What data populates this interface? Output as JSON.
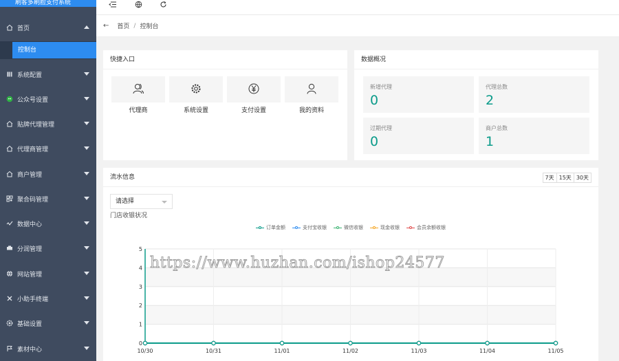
{
  "brand": "刷客多刷脸支付系统",
  "sidebar": {
    "items": [
      {
        "label": "首页",
        "icon": "home-icon"
      },
      {
        "label": "系统配置",
        "icon": "settings-icon"
      },
      {
        "label": "公众号设置",
        "icon": "wechat-icon"
      },
      {
        "label": "贴牌代理管理",
        "icon": "home-icon"
      },
      {
        "label": "代理商管理",
        "icon": "home-icon"
      },
      {
        "label": "商户管理",
        "icon": "home-icon"
      },
      {
        "label": "聚合码管理",
        "icon": "qrcode-icon"
      },
      {
        "label": "数据中心",
        "icon": "chart-icon"
      },
      {
        "label": "分润管理",
        "icon": "money-icon"
      },
      {
        "label": "网站管理",
        "icon": "globe-icon"
      },
      {
        "label": "小助手终端",
        "icon": "tools-icon"
      },
      {
        "label": "基础设置",
        "icon": "gear-icon"
      },
      {
        "label": "素材中心",
        "icon": "flag-icon"
      }
    ],
    "active_sub": "控制台"
  },
  "breadcrumb": {
    "home": "首页",
    "separator": "/",
    "current": "控制台"
  },
  "quick": {
    "title": "快捷入口",
    "entries": [
      {
        "label": "代理商",
        "icon": "users-icon"
      },
      {
        "label": "系统设置",
        "icon": "gear-icon"
      },
      {
        "label": "支付设置",
        "icon": "yen-icon"
      },
      {
        "label": "我的资料",
        "icon": "user-icon"
      }
    ]
  },
  "overview": {
    "title": "数据概况",
    "stats": [
      {
        "label": "新增代理",
        "value": "0"
      },
      {
        "label": "代理总数",
        "value": "2"
      },
      {
        "label": "过期代理",
        "value": "0"
      },
      {
        "label": "商户总数",
        "value": "1"
      }
    ]
  },
  "flow": {
    "title": "流水信息",
    "ranges": [
      "7天",
      "15天",
      "30天"
    ],
    "select_value": "请选择",
    "subtitle": "门店收银状况"
  },
  "chart_data": {
    "type": "line",
    "x": [
      "10/30",
      "10/31",
      "11/01",
      "11/02",
      "11/03",
      "11/04",
      "11/05"
    ],
    "ylim": [
      0,
      5
    ],
    "yticks": [
      0,
      1,
      2,
      3,
      4,
      5
    ],
    "legend_position": "top",
    "series": [
      {
        "name": "订单金额",
        "color": "#0b9b8a",
        "values": [
          0,
          0,
          0,
          0,
          0,
          0,
          0
        ]
      },
      {
        "name": "支付宝收银",
        "color": "#2d8cf0",
        "values": [
          0,
          0,
          0,
          0,
          0,
          0,
          0
        ]
      },
      {
        "name": "微信收银",
        "color": "#3cb371",
        "values": [
          0,
          0,
          0,
          0,
          0,
          0,
          0
        ]
      },
      {
        "name": "现金收银",
        "color": "#f5a623",
        "values": [
          0,
          0,
          0,
          0,
          0,
          0,
          0
        ]
      },
      {
        "name": "会员余额收银",
        "color": "#e04a4a",
        "values": [
          0,
          0,
          0,
          0,
          0,
          0,
          0
        ]
      }
    ]
  },
  "watermark": "https://www.huzhan.com/ishop24577"
}
